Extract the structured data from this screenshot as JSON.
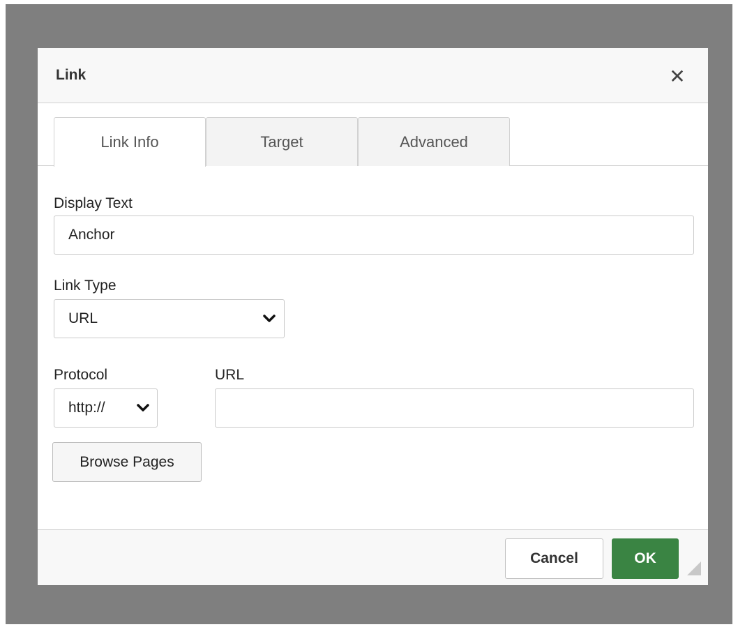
{
  "dialog": {
    "title": "Link",
    "close_icon": "close-icon"
  },
  "tabs": [
    {
      "label": "Link Info",
      "active": true
    },
    {
      "label": "Target",
      "active": false
    },
    {
      "label": "Advanced",
      "active": false
    }
  ],
  "form": {
    "display_text_label": "Display Text",
    "display_text_value": "Anchor",
    "link_type_label": "Link Type",
    "link_type_value": "URL",
    "protocol_label": "Protocol",
    "protocol_value": "http://",
    "url_label": "URL",
    "url_value": "",
    "browse_label": "Browse Pages"
  },
  "footer": {
    "cancel_label": "Cancel",
    "ok_label": "OK"
  },
  "colors": {
    "overlay": "#7f7f7f",
    "ok_button": "#3a8443",
    "header_bg": "#f8f8f8"
  }
}
